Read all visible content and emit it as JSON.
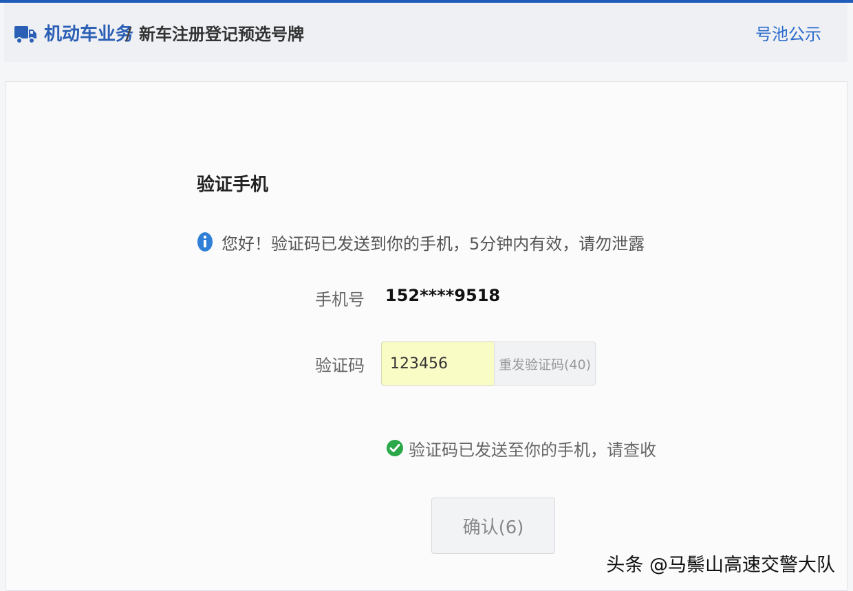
{
  "header": {
    "breadcrumb_main": "机动车业务",
    "breadcrumb_separator": "/",
    "breadcrumb_sub": "新车注册登记预选号牌",
    "link_label": "号池公示",
    "icon": "truck-icon",
    "accent_color": "#2a5fb5"
  },
  "main": {
    "title": "验证手机",
    "info_message": "您好！验证码已发送到你的手机，5分钟内有效，请勿泄露",
    "info_icon": "info-icon",
    "phone_label": "手机号",
    "phone_value": "152****9518",
    "code_label": "验证码",
    "code_value": "123456",
    "resend_label": "重发验证码(40)",
    "success_message": "验证码已发送至你的手机，请查收",
    "success_icon": "check-circle-icon",
    "confirm_label": "确认(6)"
  },
  "watermark": "头条 @马鬃山高速交警大队"
}
